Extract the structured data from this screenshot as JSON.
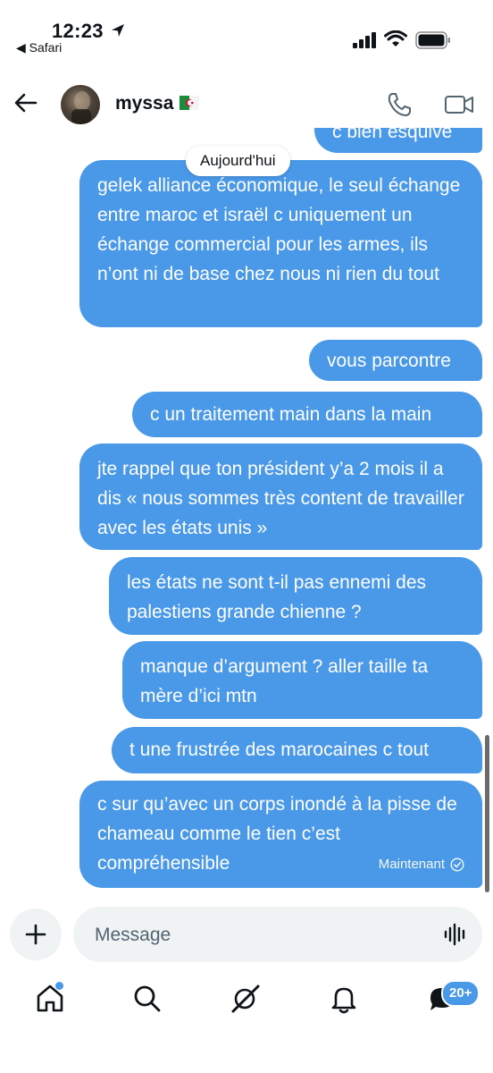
{
  "status_bar": {
    "time": "12:23",
    "back_label": "◀ Safari"
  },
  "header": {
    "name": "myssa",
    "flag": "algeria-flag"
  },
  "conversation": {
    "partial_message": "c bien esquivé",
    "day_separator": "Aujourd'hui",
    "messages": [
      {
        "text": "gelek alliance économique, le seul échange entre maroc et israël c uniquement un échange commercial pour les armes, ils n’ont ni de base chez nous ni rien du tout"
      },
      {
        "text": "vous parcontre"
      },
      {
        "text": "c un traitement main dans la main"
      },
      {
        "text": "jte rappel que ton président y’a 2 mois il a dis « nous sommes très content de travailler avec les états unis »"
      },
      {
        "text": "les états ne sont t-il pas ennemi des palestiens grande chienne ?"
      },
      {
        "text": "manque d’argument ? aller taille ta mère d’ici mtn"
      },
      {
        "text": "t une frustrée des marocaines c tout"
      },
      {
        "text": "c sur qu’avec un corps inondé à la pisse de chameau comme le tien c’est compréhensible",
        "timestamp": "Maintenant"
      }
    ]
  },
  "composer": {
    "placeholder": "Message"
  },
  "bottom_nav": {
    "messages_badge": "20+"
  },
  "colors": {
    "bubble": "#4a99e9",
    "composer_bg": "#eff3f4",
    "text": "#0f1419"
  }
}
